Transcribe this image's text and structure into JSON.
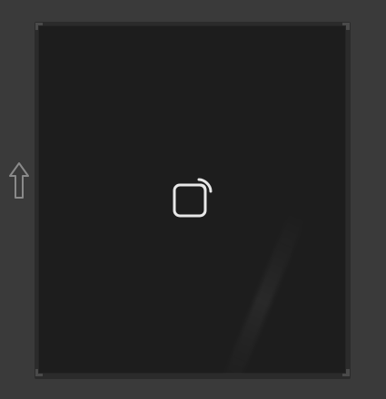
{
  "window": {
    "title": ""
  },
  "icons": {
    "main": "cast-screen-icon",
    "side": "up-arrow-icon"
  },
  "colors": {
    "background": "#3a3a3a",
    "viewport": "#1d1d1d",
    "icon_stroke": "#e7e7e7"
  }
}
